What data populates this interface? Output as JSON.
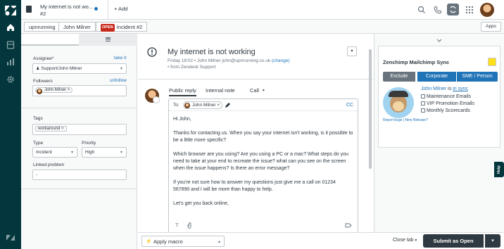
{
  "tab": {
    "title": "My internet is not wo...",
    "number": "#2",
    "add_label": "+ Add"
  },
  "breadcrumb": {
    "org": "upnrunning",
    "user": "John Milner",
    "status_badge": "OPEN",
    "incident": "Incident #2"
  },
  "apps_label": "Apps",
  "properties": {
    "assignee_label": "Assignee*",
    "take_it": "take it",
    "assignee_value": "Support/John Milner",
    "followers_label": "Followers",
    "unfollow": "unfollow",
    "follower_name": "John Milner",
    "tags_label": "Tags",
    "tag_value": "workaround",
    "type_label": "Type",
    "type_value": "Incident",
    "priority_label": "Priority",
    "priority_value": "High",
    "linked_label": "Linked problem",
    "linked_value": "-"
  },
  "ticket": {
    "title": "My internet is not working",
    "meta_prefix": "Friday 18:02 • John Milner",
    "meta_email": "john@upnrunning.co.uk",
    "meta_change": "(change)",
    "source": "• from Zendesk Support",
    "menu_icon": "chevron-down-icon"
  },
  "reply": {
    "tabs": [
      "Public reply",
      "Internal note",
      "Call"
    ],
    "to_label": "To:",
    "to_name": "John Milner",
    "cc_label": "CC",
    "body": [
      "Hi John,",
      "Thanks for contacting us. When you say your internet isn't working, is it possible to be a little more specific?",
      "Which browser are you using? Are you using a PC or a mac? What steps do you need to take at your end to recreate the issue? what can you see on the screen when the issue happens? Is there an error message?",
      "If you're not sure how to answer my questions just give me a call on 01234 567890 and I will be more than happy to help.",
      "Let's get you back online,"
    ]
  },
  "app": {
    "title": "Zenchimp Mailchimp Sync",
    "btn_exclude": "Exclude",
    "btn_corporate": "Corporate",
    "btn_sme": "SME / Person",
    "user_name": "John Milner",
    "user_status_prefix": "is",
    "user_status": "in sync",
    "lists": [
      "Maintenance Emails",
      "VIP Promotion Emails",
      "Monthly Scorecards"
    ],
    "footer_links": "Report bugs | New Release?"
  },
  "help_label": "Help",
  "bottom": {
    "macro_label": "Apply macro",
    "close_tab": "Close tab",
    "submit": "Submit as Open"
  },
  "colors": {
    "nav_bg": "#03363d",
    "accent": "#1f73b7",
    "open_badge": "#c72a1c",
    "submit_bg": "#2f3941"
  }
}
